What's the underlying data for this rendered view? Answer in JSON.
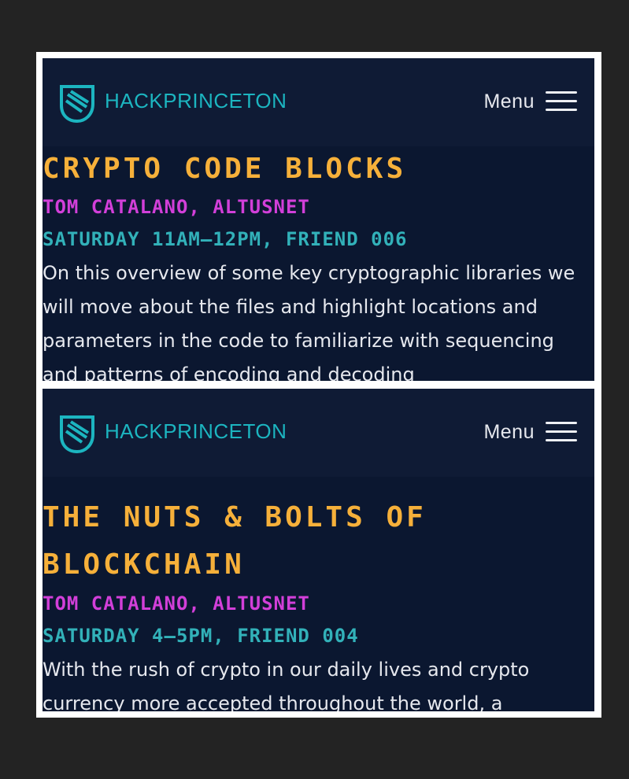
{
  "brand": {
    "name": "HACKPRINCETON",
    "logo_icon": "hackprinceton-shield-logo-icon",
    "color": "#1cb5c0"
  },
  "menu": {
    "label": "Menu",
    "icon": "hamburger-icon"
  },
  "colors": {
    "background": "#0b1730",
    "title": "#f6b03a",
    "speaker": "#d23fd9",
    "when": "#32b1b9",
    "text": "#e6e8ee"
  },
  "sessions": [
    {
      "title": "CRYPTO CODE BLOCKS",
      "speaker": "TOM CATALANO, ALTUSNET",
      "when": "SATURDAY 11AM–12PM, FRIEND 006",
      "description": "On this overview of some key cryptographic libraries we will move about the files and highlight locations and parameters in the code to familiarize with sequencing and patterns of encoding and decoding"
    },
    {
      "title": "THE NUTS & BOLTS OF BLOCKCHAIN",
      "speaker": "TOM CATALANO, ALTUSNET",
      "when": "SATURDAY 4–5PM, FRIEND 004",
      "description": "With the rush of crypto in our daily lives and crypto currency more accepted throughout the world, a"
    }
  ]
}
